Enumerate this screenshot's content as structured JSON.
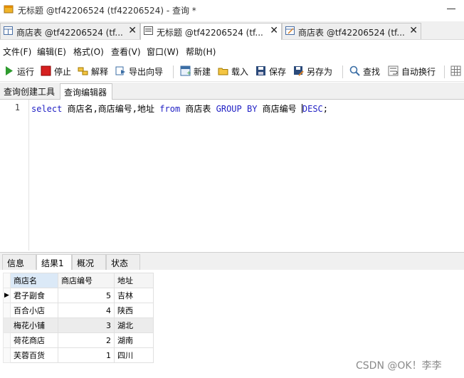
{
  "window": {
    "title": "无标题 @tf42206524 (tf42206524) - 查询 *"
  },
  "doc_tabs": [
    {
      "label": "商店表 @tf42206524 (tf...",
      "close": "✕",
      "active": false
    },
    {
      "label": "无标题 @tf42206524 (tf...",
      "close": "✕",
      "active": true
    },
    {
      "label": "商店表 @tf42206524 (tf...",
      "close": "✕",
      "active": false
    }
  ],
  "menu": [
    "文件(F)",
    "编辑(E)",
    "格式(O)",
    "查看(V)",
    "窗口(W)",
    "帮助(H)"
  ],
  "toolbar": {
    "run": "运行",
    "stop": "停止",
    "explain": "解释",
    "export": "导出向导",
    "new": "新建",
    "load": "载入",
    "save": "保存",
    "save_as": "另存为",
    "find": "查找",
    "wrap": "自动换行"
  },
  "sub_tabs": [
    "查询创建工具",
    "查询编辑器"
  ],
  "editor": {
    "line_number": "1",
    "tokens": {
      "select": "select",
      "cols": " 商店名,商店编号,地址 ",
      "from": "from",
      "table": " 商店表 ",
      "groupby": "GROUP BY",
      "key": " 商店编号 ",
      "desc": "DESC",
      "end": ";"
    }
  },
  "result_tabs": [
    "信息",
    "结果1",
    "概况",
    "状态"
  ],
  "result": {
    "columns": [
      "商店名",
      "商店编号",
      "地址"
    ],
    "rows": [
      [
        "君子副食",
        "5",
        "吉林"
      ],
      [
        "百合小店",
        "4",
        "陕西"
      ],
      [
        "梅花小铺",
        "3",
        "湖北"
      ],
      [
        "荷花商店",
        "2",
        "湖南"
      ],
      [
        "芙蓉百货",
        "1",
        "四川"
      ]
    ],
    "current_row_marker": "▶"
  },
  "watermark": "CSDN @OK！李李",
  "colors": {
    "keyword": "#1f1fc4",
    "selected_header": "#dbe9f7",
    "highlight_row": "#ececec"
  }
}
